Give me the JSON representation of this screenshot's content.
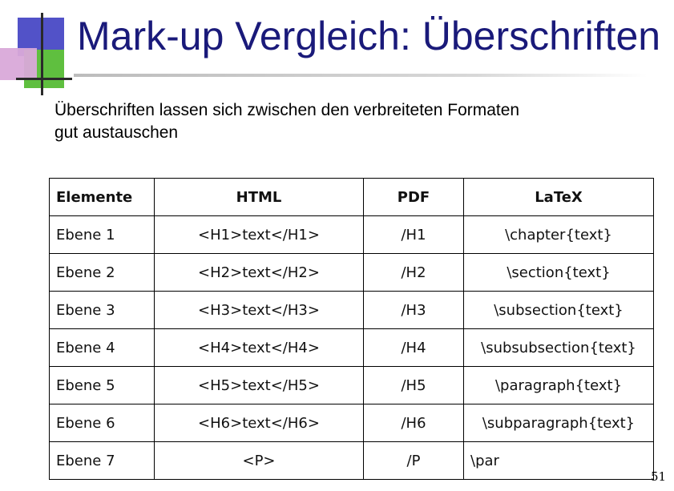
{
  "slide": {
    "title": "Mark-up Vergleich: Überschriften",
    "intro_lines": [
      "Überschriften lassen sich zwischen den verbreiteten Formaten",
      "gut austauschen"
    ],
    "page_number": "51"
  },
  "table": {
    "headers": [
      "Elemente",
      "HTML",
      "PDF",
      "LaTeX"
    ],
    "rows": [
      [
        "Ebene 1",
        "<H1>text</H1>",
        "/H1",
        "\\chapter{text}"
      ],
      [
        "Ebene 2",
        "<H2>text</H2>",
        "/H2",
        "\\section{text}"
      ],
      [
        "Ebene 3",
        "<H3>text</H3>",
        "/H3",
        "\\subsection{text}"
      ],
      [
        "Ebene 4",
        "<H4>text</H4>",
        "/H4",
        "\\subsubsection{text}"
      ],
      [
        "Ebene 5",
        "<H5>text</H5>",
        "/H5",
        "\\paragraph{text}"
      ],
      [
        "Ebene 6",
        "<H6>text</H6>",
        "/H6",
        "\\subparagraph{text}"
      ],
      [
        "Ebene 7",
        "<P>",
        "/P",
        "\\par"
      ]
    ]
  },
  "colors": {
    "title": "#1a1a7a",
    "deco_blue": "#5252c8",
    "deco_pink": "#d9a9d9",
    "deco_green": "#5fbf3f"
  }
}
